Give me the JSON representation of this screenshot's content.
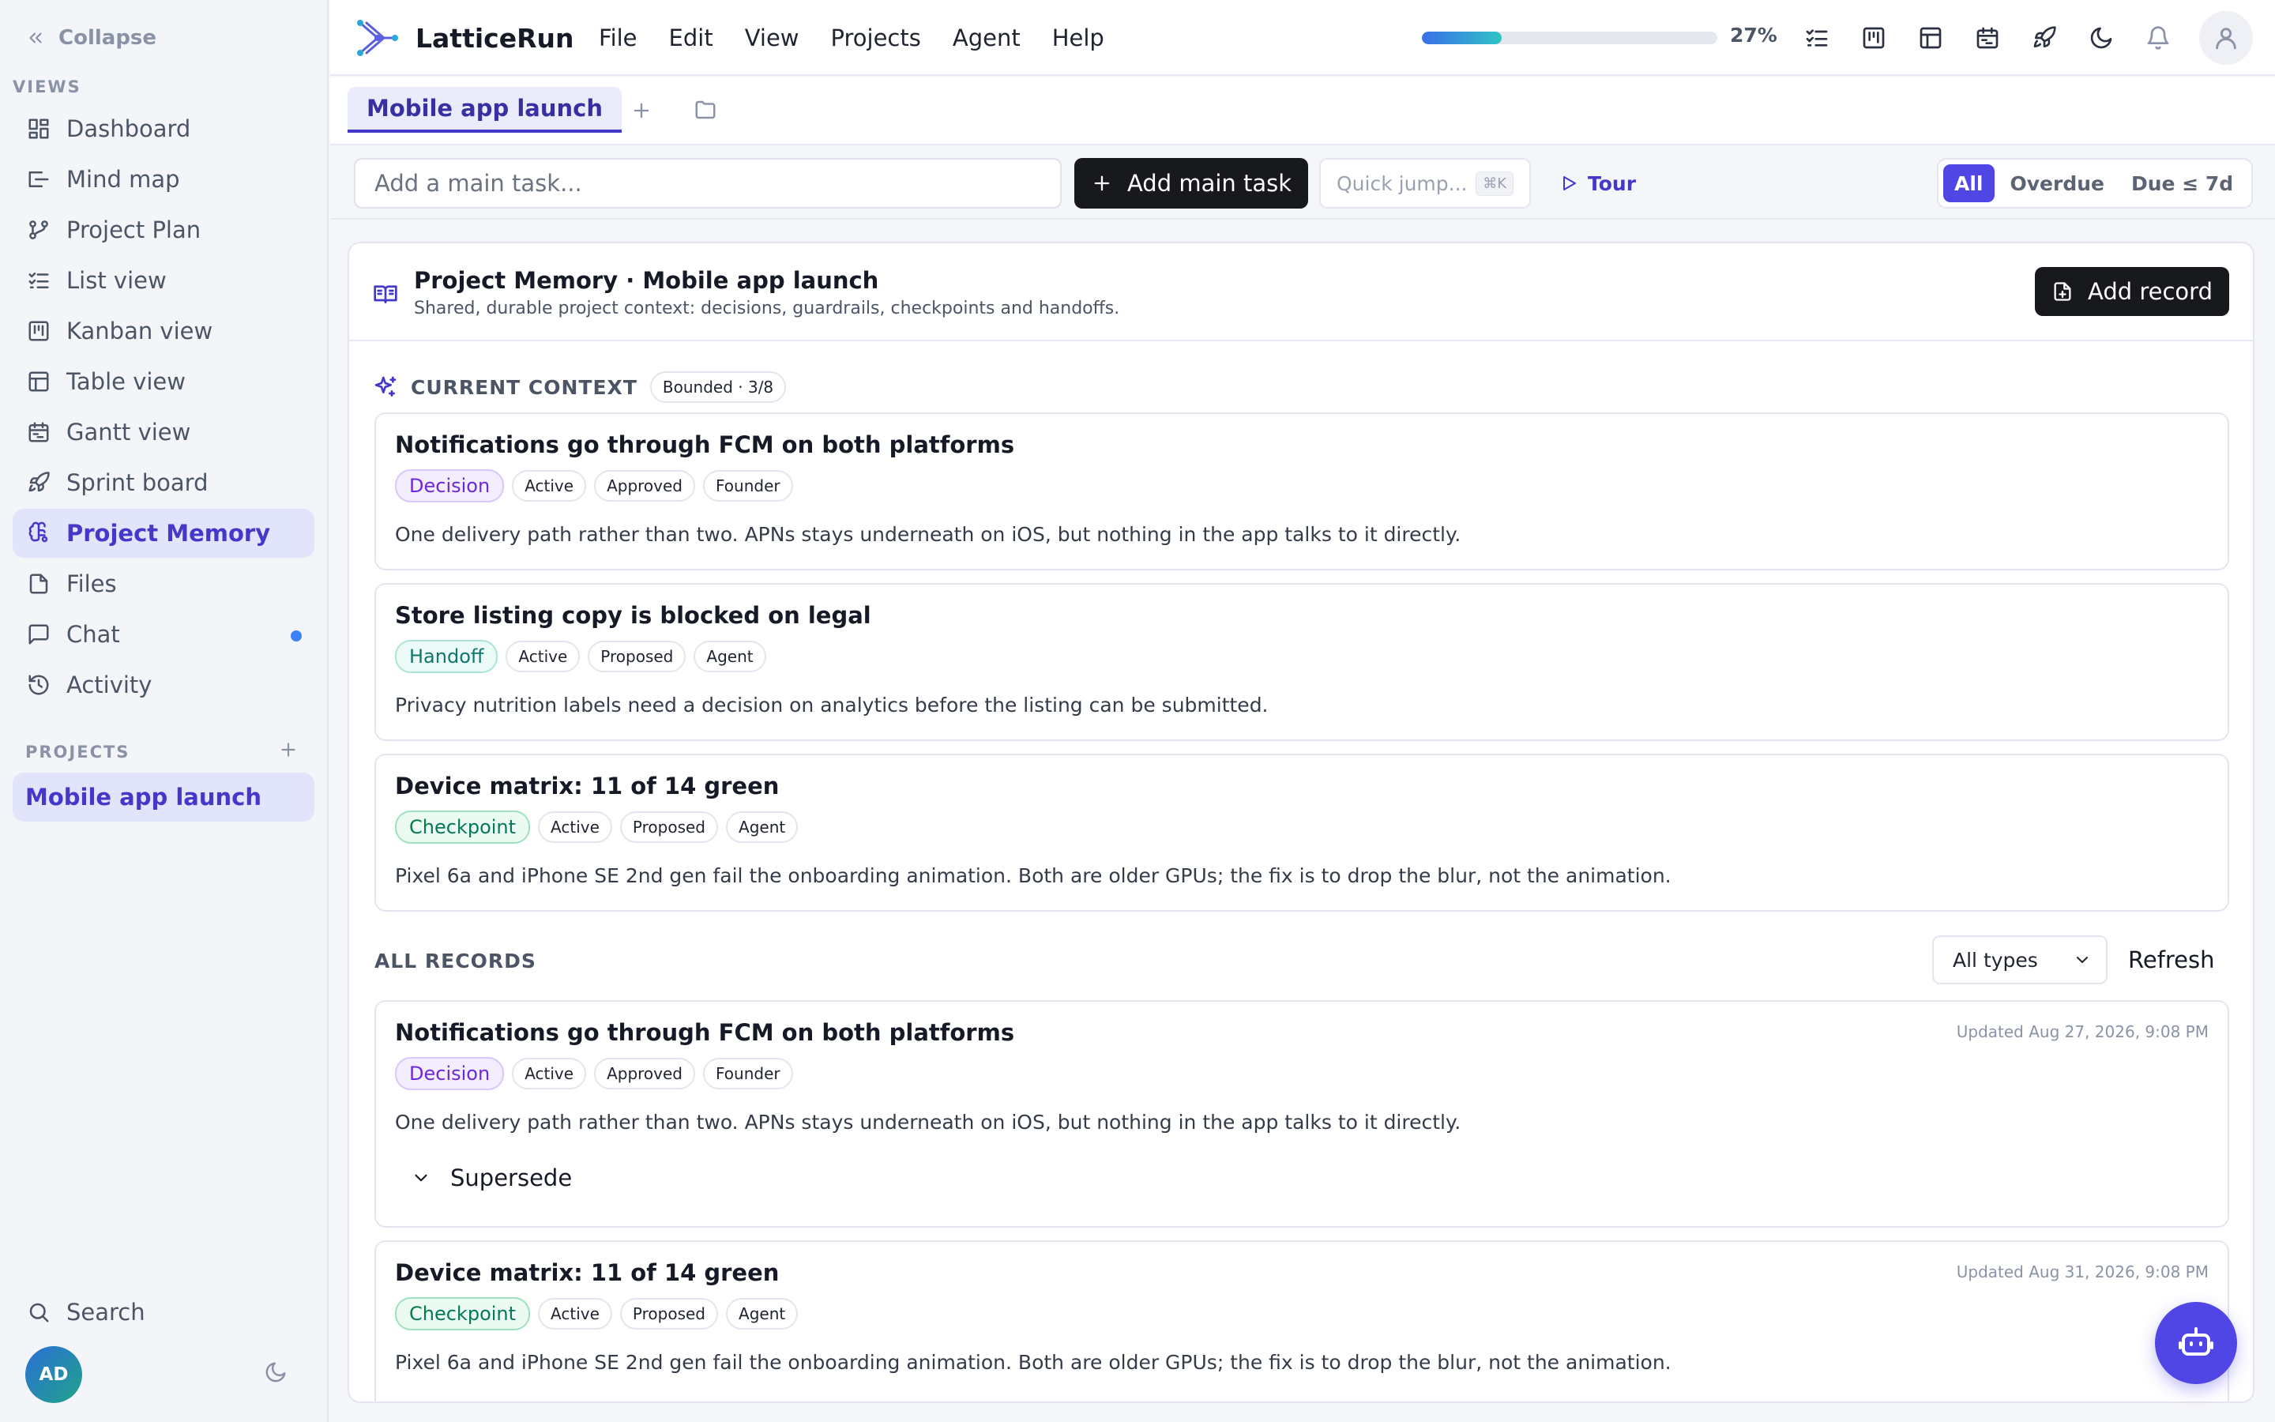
{
  "sidebar": {
    "collapse_label": "Collapse",
    "views_label": "VIEWS",
    "items": [
      {
        "label": "Dashboard",
        "icon": "dashboard-icon"
      },
      {
        "label": "Mind map",
        "icon": "mind-map-icon"
      },
      {
        "label": "Project Plan",
        "icon": "project-plan-icon"
      },
      {
        "label": "List view",
        "icon": "list-view-icon"
      },
      {
        "label": "Kanban view",
        "icon": "kanban-icon"
      },
      {
        "label": "Table view",
        "icon": "table-icon"
      },
      {
        "label": "Gantt view",
        "icon": "gantt-icon"
      },
      {
        "label": "Sprint board",
        "icon": "rocket-icon"
      },
      {
        "label": "Project Memory",
        "icon": "brain-icon",
        "active": true
      },
      {
        "label": "Files",
        "icon": "file-icon"
      },
      {
        "label": "Chat",
        "icon": "chat-icon",
        "has_unread_dot": true
      },
      {
        "label": "Activity",
        "icon": "history-icon"
      }
    ],
    "projects_label": "PROJECTS",
    "projects": [
      "Mobile app launch"
    ],
    "search_label": "Search",
    "avatar_initials": "AD"
  },
  "topbar": {
    "brand": "LatticeRun",
    "menus": [
      "File",
      "Edit",
      "View",
      "Projects",
      "Agent",
      "Help"
    ],
    "progress_pct": 27,
    "progress_label": "27%"
  },
  "tabs": {
    "active_tab": "Mobile app launch"
  },
  "toolbar": {
    "task_placeholder": "Add a main task...",
    "add_main_label": "Add main task",
    "quick_jump_placeholder": "Quick jump...",
    "quick_jump_shortcut": "⌘K",
    "tour_label": "Tour",
    "filters": [
      "All",
      "Overdue",
      "Due ≤ 7d"
    ],
    "active_filter": "All"
  },
  "panel": {
    "title": "Project Memory · Mobile app launch",
    "subtitle": "Shared, durable project context: decisions, guardrails, checkpoints and handoffs.",
    "add_record_label": "Add record",
    "context_title": "CURRENT CONTEXT",
    "context_badge": "Bounded · 3/8",
    "context_cards": [
      {
        "title": "Notifications go through FCM on both platforms",
        "type": "Decision",
        "tags": [
          "Active",
          "Approved",
          "Founder"
        ],
        "body": "One delivery path rather than two. APNs stays underneath on iOS, but nothing in the app talks to it directly."
      },
      {
        "title": "Store listing copy is blocked on legal",
        "type": "Handoff",
        "tags": [
          "Active",
          "Proposed",
          "Agent"
        ],
        "body": "Privacy nutrition labels need a decision on analytics before the listing can be submitted."
      },
      {
        "title": "Device matrix: 11 of 14 green",
        "type": "Checkpoint",
        "tags": [
          "Active",
          "Proposed",
          "Agent"
        ],
        "body": "Pixel 6a and iPhone SE 2nd gen fail the onboarding animation. Both are older GPUs; the fix is to drop the blur, not the animation."
      }
    ],
    "all_records_title": "ALL RECORDS",
    "type_filter_value": "All types",
    "refresh_label": "Refresh",
    "records": [
      {
        "title": "Notifications go through FCM on both platforms",
        "type": "Decision",
        "tags": [
          "Active",
          "Approved",
          "Founder"
        ],
        "body": "One delivery path rather than two. APNs stays underneath on iOS, but nothing in the app talks to it directly.",
        "updated": "Updated Aug 27, 2026, 9:08 PM",
        "action": "Supersede"
      },
      {
        "title": "Device matrix: 11 of 14 green",
        "type": "Checkpoint",
        "tags": [
          "Active",
          "Proposed",
          "Agent"
        ],
        "body": "Pixel 6a and iPhone SE 2nd gen fail the onboarding animation. Both are older GPUs; the fix is to drop the blur, not the animation.",
        "updated": "Updated Aug 31, 2026, 9:08 PM"
      }
    ]
  },
  "colors": {
    "accent": "#4f46e5",
    "accent_text": "#4338ca",
    "active_bg": "#e1e4fb",
    "dark_button": "#18191d"
  }
}
